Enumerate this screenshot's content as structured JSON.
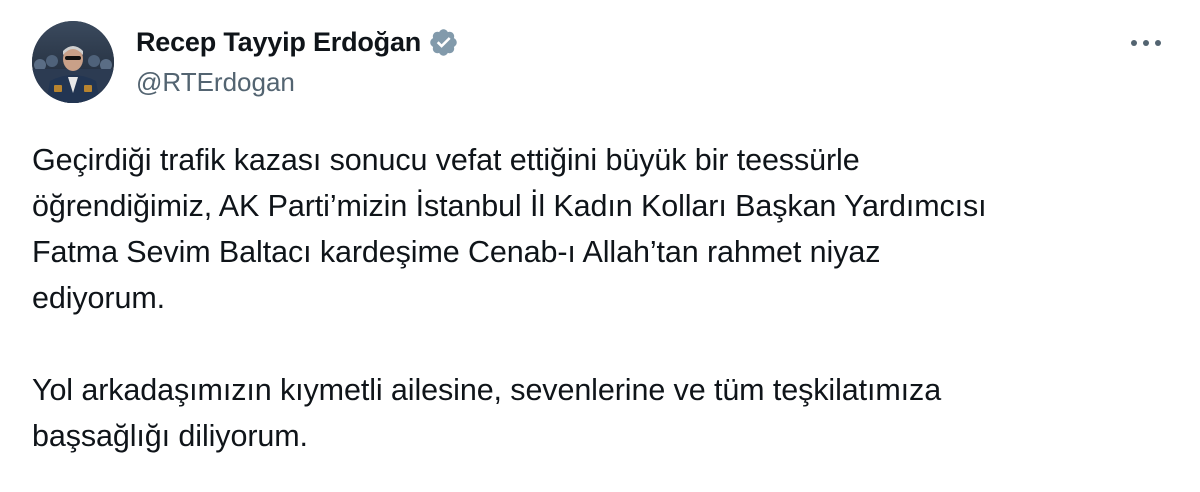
{
  "author": {
    "display_name": "Recep Tayyip Erdoğan",
    "handle": "@RTErdogan",
    "verified_icon": "verified-badge-icon",
    "badge_color": "#829aab"
  },
  "menu": {
    "icon": "more-options-icon"
  },
  "tweet": {
    "paragraphs": [
      "Geçirdiği trafik kazası sonucu vefat ettiğini büyük bir teessürle\nöğrendiğimiz, AK Parti’mizin İstanbul İl Kadın Kolları Başkan Yardımcısı\nFatma Sevim Baltacı kardeşime Cenab-ı Allah’tan rahmet niyaz\nediyorum.",
      "Yol arkadaşımızın kıymetli ailesine, sevenlerine ve tüm teşkilatımıza\nbaşsağlığı diliyorum."
    ]
  }
}
